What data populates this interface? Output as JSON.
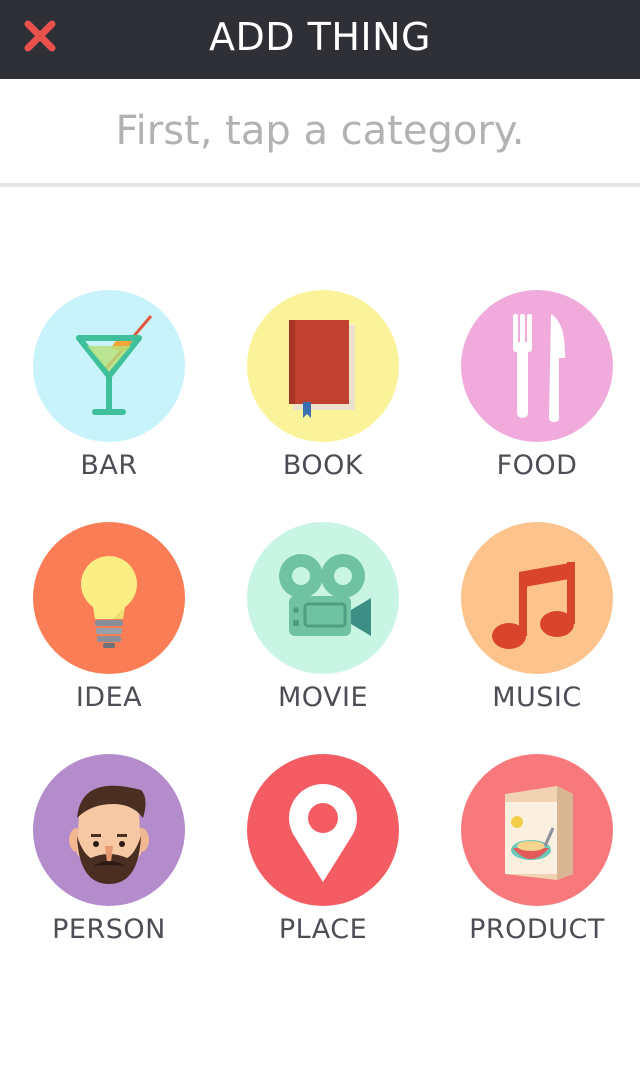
{
  "header": {
    "title": "ADD THING",
    "close_icon": "close-icon",
    "close_color": "#e8524a",
    "background": "#2f2f36"
  },
  "prompt": {
    "text": "First, tap a category."
  },
  "categories": [
    {
      "label": "BAR",
      "icon": "cocktail-icon",
      "color": "#c9f3fb"
    },
    {
      "label": "BOOK",
      "icon": "book-icon",
      "color": "#fbf39a"
    },
    {
      "label": "FOOD",
      "icon": "fork-knife-icon",
      "color": "#f0aadb"
    },
    {
      "label": "IDEA",
      "icon": "lightbulb-icon",
      "color": "#fb7d55"
    },
    {
      "label": "MOVIE",
      "icon": "movie-camera-icon",
      "color": "#c9f6e4"
    },
    {
      "label": "MUSIC",
      "icon": "music-note-icon",
      "color": "#fcc38d"
    },
    {
      "label": "PERSON",
      "icon": "bearded-face-icon",
      "color": "#b48ccc"
    },
    {
      "label": "PLACE",
      "icon": "map-pin-icon",
      "color": "#f35c63"
    },
    {
      "label": "PRODUCT",
      "icon": "cereal-box-icon",
      "color": "#f7797b"
    }
  ]
}
